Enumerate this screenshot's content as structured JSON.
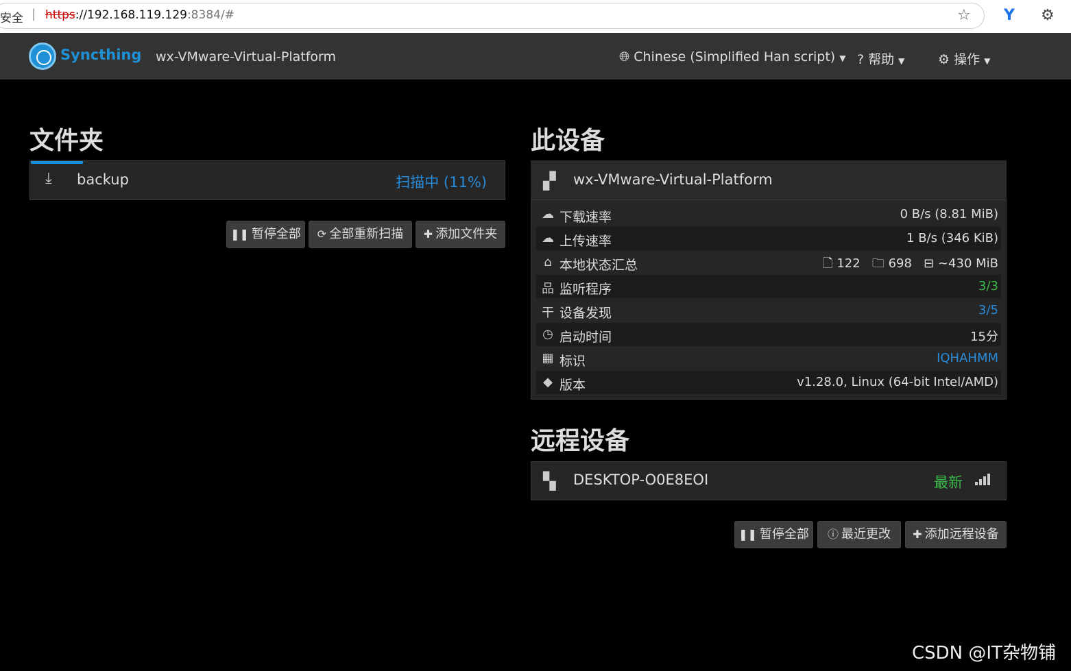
{
  "browser": {
    "security_label": "安全",
    "separator": "|",
    "url_scheme": "https",
    "url_host": "://192.168.119.129",
    "url_rest": ":8384/#",
    "star_icon": "star-icon",
    "extension_label": "Y"
  },
  "navbar": {
    "brand": "Syncthing",
    "hostname": "wx-VMware-Virtual-Platform",
    "language": "Chinese (Simplified Han script)",
    "help": "帮助",
    "actions": "操作"
  },
  "folders": {
    "heading": "文件夹",
    "items": [
      {
        "name": "backup",
        "status": "扫描中 (11%)",
        "progress": 0.11
      }
    ],
    "buttons": {
      "pause_all": "暂停全部",
      "rescan_all": "全部重新扫描",
      "add_folder": "添加文件夹"
    }
  },
  "this_device": {
    "heading": "此设备",
    "name": "wx-VMware-Virtual-Platform",
    "rows": [
      {
        "icon": "cloud-download-icon",
        "label": "下载速率",
        "value": "0 B/s (8.81 MiB)"
      },
      {
        "icon": "cloud-upload-icon",
        "label": "上传速率",
        "value": "1 B/s (346 KiB)"
      },
      {
        "icon": "home-icon",
        "label": "本地状态汇总",
        "files": "122",
        "dirs": "698",
        "size": "~430 MiB"
      },
      {
        "icon": "sitemap-icon",
        "label": "监听程序",
        "value": "3/3"
      },
      {
        "icon": "signpost-icon",
        "label": "设备发现",
        "value": "3/5"
      },
      {
        "icon": "clock-icon",
        "label": "启动时间",
        "value": "15分"
      },
      {
        "icon": "qrcode-icon",
        "label": "标识",
        "value": "IQHAHMM"
      },
      {
        "icon": "tag-icon",
        "label": "版本",
        "value": "v1.28.0, Linux (64-bit Intel/AMD)"
      }
    ]
  },
  "remote_devices": {
    "heading": "远程设备",
    "items": [
      {
        "name": "DESKTOP-O0E8EOI",
        "status": "最新"
      }
    ],
    "buttons": {
      "pause_all": "暂停全部",
      "recent_changes": "最近更改",
      "add_remote": "添加远程设备"
    }
  },
  "watermark": "CSDN @IT杂物铺",
  "colors": {
    "accent": "#1e90d6",
    "ok_green": "#3cb84a",
    "navbar": "#333333",
    "background": "#000000"
  }
}
